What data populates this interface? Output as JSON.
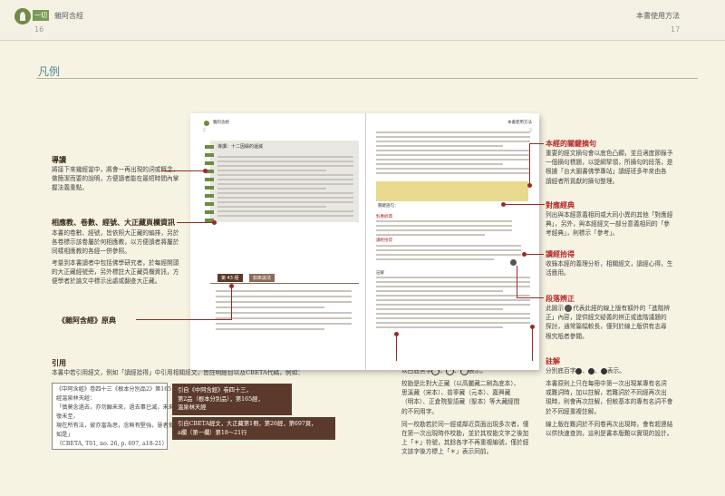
{
  "header": {
    "left_tag": "一切",
    "left_title": "雜阿含經",
    "left_page": "16",
    "right_title": "本書使用方法",
    "right_page": "17"
  },
  "section_title": "凡例",
  "left_notes": {
    "guide_title": "導讀",
    "guide_text": [
      "將接下來幾經當中，將會一再出現的詞或概念，",
      "做簡潔而要的說明，方便讀者能在最短時間內掌",
      "握法義重點。"
    ],
    "related_title": "相應教、卷數、經號、大正藏頁欄資訊",
    "related_text": [
      "本書的卷數、經號，皆依照大正藏的編排，另於",
      "各卷標示該卷屬於何相應教，以方便讀者將屬於",
      "同樣相應教的各經一併參照。"
    ],
    "study_text": [
      "考量到本書讀者中包括佛學研究者，於每經開頭",
      "的大正藏經號旁，另外標註大正藏頁欄資訊，方",
      "便學者於論文中標示出處或翻查大正藏。"
    ],
    "original_title": "《雜阿含經》原典"
  },
  "right_notes": {
    "key_title": "本經的關鍵摘句",
    "key_text": [
      "重要的經文摘句會以底色凸顯，並且適度節錄予",
      "一個摘句標題，以提綱挈領，所摘句的段落，是",
      "根據「台大圖書佛學專站」讀經班多年來由各",
      "讀經者所貢獻的摘句整理。"
    ],
    "parallel_title": "對應經典",
    "parallel_text": [
      "列出與本經意義相同或大同小異的其他「對應經",
      "典」，另外，與本經經文一部分意義相同的「參",
      "考經典」，則標示「參考」。"
    ],
    "maxim_title": "讀經拾得",
    "maxim_text": [
      "收錄本經的義理分析，相關經文，讀經心得，生",
      "活應用。"
    ],
    "diff_title": "段落辨正",
    "diff_text": [
      "此圖示",
      "代表此經的線上版有額外的「進階辨",
      "正」內容，提供經文疑義的辨正或進階議題的",
      "探討，通常篇幅較長，僅列於線上版供有志尋",
      "根究柢者參閱。"
    ],
    "note_title": "註解",
    "note_text": [
      "分別底百字",
      "、",
      "、",
      "表示。"
    ],
    "note_body": [
      "本書原則上只在每冊中第一次出現某專有名詞",
      "或難詞時，加以註解，若難詞於不同經再次出",
      "現時，則會再次註解，但較基本的專有名詞不會",
      "於不同經重複註解。",
      "線上版在難詞於不同卷再次出現時，會有超連結",
      "以供快速查詢，這則是書本版難以實現的設計。"
    ]
  },
  "collation": {
    "title": "校勘",
    "sub": [
      "以白底黑字",
      "、",
      "、",
      "表示。"
    ],
    "text": [
      "校勘是比對大正藏（以高麗藏二刷為底本）、",
      "思溪藏（宋本）、普寧藏（元本）、嘉興藏",
      "（明本）、正倉院聖語藏（聖本）等大藏經間",
      "的不同用字。",
      "同一校勘若於同一經或鄰近頁面出現多次者，僅",
      "在第一次出現時作校勘，並於其校勘文字之後加",
      "上「＊」符號，其餘各字不再重複編號，僅於經",
      "文該字後方標上「＊」表示同前。"
    ]
  },
  "citation": {
    "title": "引用",
    "intro": "本書中若引用經文，例如「讀經拾得」中引用相關經文，皆註明經目以及CBETA代碼，例如：",
    "box": [
      "《中阿含經》卷四十三《根本分別品2》第165經溫泉林天經：",
      "「慎莫念過去，亦勿願未來，過去事已滅，未來復未至，",
      "現在所有法，彼亦當為思，念無有堅強，慧者覺如是」",
      "（CBETA, T01, no. 26, p. 697, a18-21）"
    ],
    "label1": [
      "引自《中阿含經》卷四十三，",
      "第2品（根本分別品），第165經，",
      "溫泉林天經"
    ],
    "label2": [
      "引自CBETA經文，大正藏第1冊，第26經，第697頁，",
      "a欄（第一欄）第18～21行"
    ]
  },
  "book": {
    "left_header": "雜阿含經",
    "left_page": "2",
    "chapter_label": "導讀：十二因緣的還滅",
    "sutra_number": "第 43 經",
    "sutra_title": "如來說法",
    "right_header": "本書使用方法",
    "right_page": "3",
    "key_title": "關鍵語句：",
    "parallel": "對應經典",
    "maxim": "讀經拾得",
    "annotations": "註解"
  },
  "colors": {
    "accent": "#9b2a2a",
    "title_teal": "#4a8a95",
    "highlight": "#e9d98e"
  }
}
